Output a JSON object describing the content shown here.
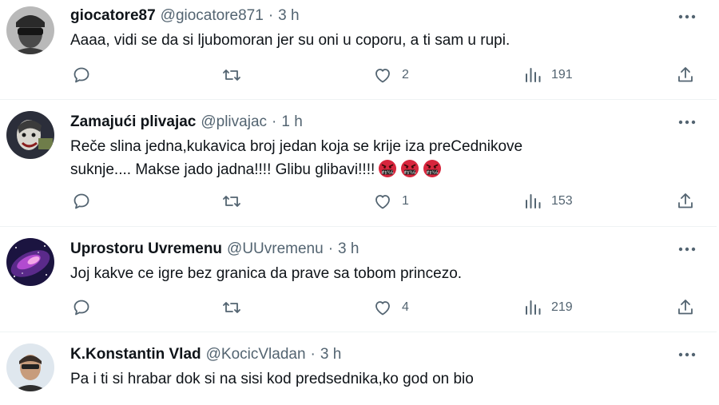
{
  "tweets": [
    {
      "name": "giocatore87",
      "handle": "@giocatore871",
      "separator": "·",
      "time": "3 h",
      "text": "Aaaa, vidi se da si ljubomoran jer su oni u coporu, a ti sam u rupi.",
      "text_line2": "",
      "likes": "2",
      "views": "191"
    },
    {
      "name": "Zamajući plivajac",
      "handle": "@plivajac",
      "separator": "·",
      "time": "1 h",
      "text": "Reče slina jedna,kukavica broj jedan koja se krije iza preCednikove",
      "text_line2": "suknje.... Makse jado jadna!!!! Glibu glibavi!!!!",
      "likes": "1",
      "views": "153"
    },
    {
      "name": "Uprostoru Uvremenu",
      "handle": "@UUvremenu",
      "separator": "·",
      "time": "3 h",
      "text": "Joj kakve ce igre bez granica da prave sa tobom princezo.",
      "text_line2": "",
      "likes": "4",
      "views": "219"
    },
    {
      "name": "K.Konstantin Vlad",
      "handle": "@KocicVladan",
      "separator": "·",
      "time": "3 h",
      "text": "Pa i ti si hrabar dok si na sisi kod predsednika,ko god on bio",
      "text_line2": ""
    }
  ],
  "icons": [
    "more-icon",
    "reply-icon",
    "retweet-icon",
    "like-icon",
    "views-icon",
    "share-icon",
    "cursing-face-emoji"
  ],
  "colors": {
    "text": "#0f1419",
    "secondary": "#536471",
    "divider": "#eff3f4",
    "emoji_red": "#d7263d"
  }
}
